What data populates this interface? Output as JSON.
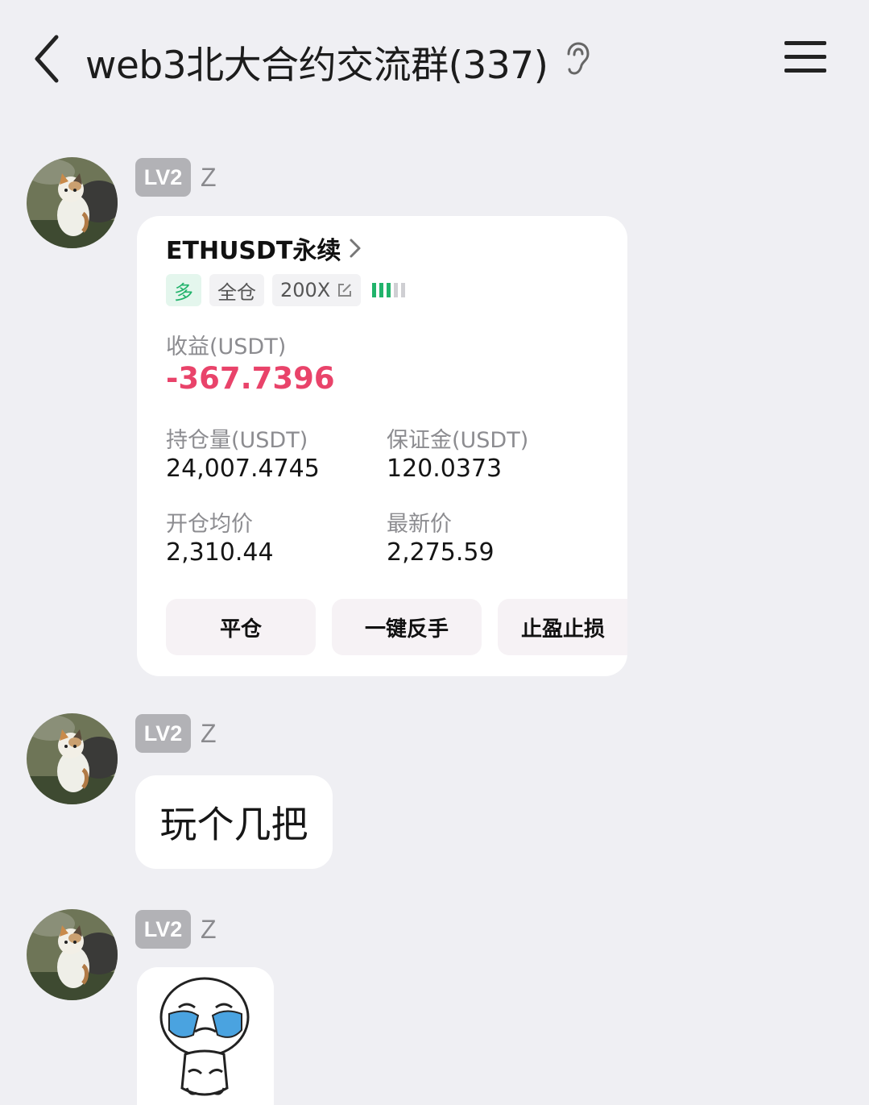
{
  "header": {
    "title": "web3北大合约交流群(337)"
  },
  "messages": [
    {
      "level": "LV2",
      "user": "Z"
    },
    {
      "level": "LV2",
      "user": "Z",
      "text": "玩个几把"
    },
    {
      "level": "LV2",
      "user": "Z"
    }
  ],
  "position_card": {
    "symbol": "ETHUSDT永续",
    "side": "多",
    "margin_mode": "全仓",
    "leverage": "200X",
    "pnl_label": "收益(USDT)",
    "pnl_value": "-367.7396",
    "size_label": "持仓量(USDT)",
    "size_value": "24,007.4745",
    "margin_label": "保证金(USDT)",
    "margin_value": "120.0373",
    "entry_label": "开仓均价",
    "entry_value": "2,310.44",
    "last_label": "最新价",
    "last_value": "2,275.59",
    "buttons": [
      "平仓",
      "一键反手",
      "止盈止损"
    ]
  },
  "colors": {
    "pnl_negative": "#e9436a",
    "long_green": "#21b36b",
    "level_badge": "#b2b2b6"
  },
  "icons": {
    "back": "chevron-left-icon",
    "hearing": "ear-icon",
    "menu": "hamburger-icon",
    "edit": "edit-icon",
    "risk": "signal-bars-icon"
  }
}
